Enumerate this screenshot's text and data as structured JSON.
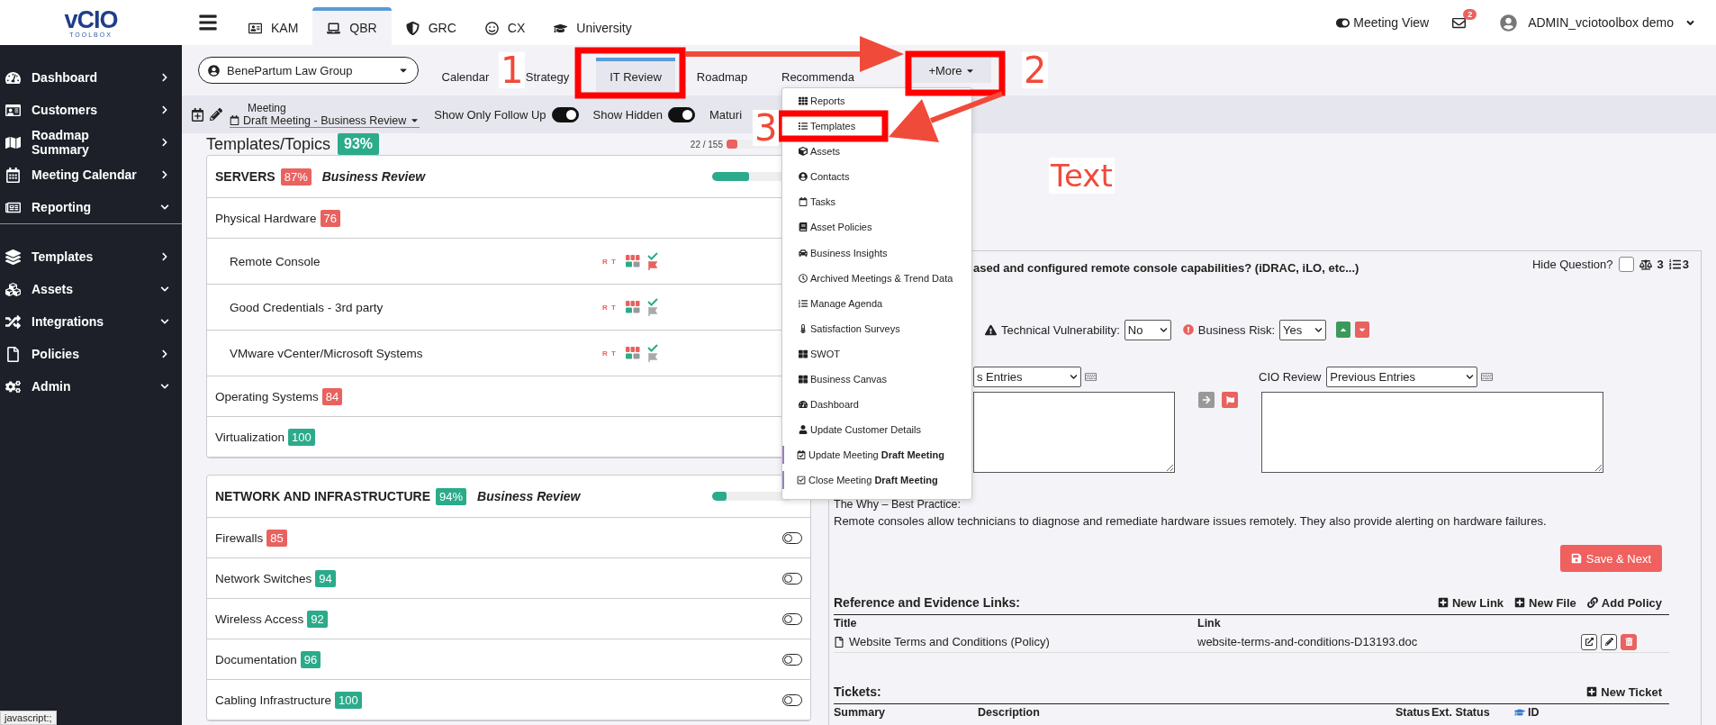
{
  "logo": {
    "name": "vCIO",
    "tagline": "TOOLBOX"
  },
  "sidebar": {
    "main_items": [
      {
        "label": "Dashboard",
        "expanded": false
      },
      {
        "label": "Customers",
        "expanded": false
      },
      {
        "label": "Roadmap Summary",
        "expanded": false
      },
      {
        "label": "Meeting Calendar",
        "expanded": false
      },
      {
        "label": "Reporting",
        "expanded": true
      }
    ],
    "setup_items": [
      {
        "label": "Templates",
        "expanded": false
      },
      {
        "label": "Assets",
        "expanded": true
      },
      {
        "label": "Integrations",
        "expanded": true
      },
      {
        "label": "Policies",
        "expanded": false
      },
      {
        "label": "Admin",
        "expanded": true
      }
    ]
  },
  "top_tabs": [
    {
      "label": "KAM",
      "selected": false
    },
    {
      "label": "QBR",
      "selected": true
    },
    {
      "label": "GRC",
      "selected": false
    },
    {
      "label": "CX",
      "selected": false
    },
    {
      "label": "University",
      "selected": false
    }
  ],
  "header_right": {
    "meeting_view": "Meeting View",
    "mail_count": "2",
    "user": "ADMIN_vciotoolbox demo"
  },
  "customer_select": {
    "value": "BenePartum Law Group"
  },
  "sub_tabs": [
    {
      "label": "Calendar",
      "selected": false
    },
    {
      "label": "Strategy",
      "selected": false
    },
    {
      "label": "IT Review",
      "selected": true
    },
    {
      "label": "Roadmap",
      "selected": false
    },
    {
      "label": "Recommenda",
      "selected": false
    }
  ],
  "more_button": "+More",
  "meeting_bar": {
    "label": "Meeting",
    "value": "Draft Meeting - Business Review",
    "toggles": [
      {
        "label": "Show Only Follow Up",
        "on": true
      },
      {
        "label": "Show Hidden",
        "on": true
      }
    ],
    "cut_label": "Maturi"
  },
  "topics": {
    "title": "Templates/Topics",
    "score": "93%",
    "progress_text": "22 / 155",
    "level": 0.14,
    "sections": [
      {
        "name": "SERVERS",
        "score": "87%",
        "color": "#e8625f",
        "meeting": "Business Review",
        "level": 0.45,
        "topics": [
          {
            "name": "Physical Hardware",
            "score": "76",
            "color": "#e8625f",
            "children": [
              {
                "name": "Remote Console",
                "tag": "R T",
                "flagged": true
              },
              {
                "name": "Good Credentials - 3rd party",
                "tag": "R T",
                "flagged": false
              },
              {
                "name": "VMware vCenter/Microsoft Systems",
                "tag": "R T",
                "flagged": false
              }
            ]
          },
          {
            "name": "Operating Systems",
            "score": "84",
            "color": "#e8625f"
          },
          {
            "name": "Virtualization",
            "score": "100",
            "color": "#2bab8a"
          }
        ]
      },
      {
        "name": "NETWORK AND INFRASTRUCTURE",
        "score": "94%",
        "color": "#2bab8a",
        "meeting": "Business Review",
        "level": 0.18,
        "topics": [
          {
            "name": "Firewalls",
            "score": "85",
            "color": "#e8625f",
            "on": false
          },
          {
            "name": "Network Switches",
            "score": "94",
            "color": "#2bab8a",
            "on": false
          },
          {
            "name": "Wireless Access",
            "score": "92",
            "color": "#2bab8a",
            "on": false
          },
          {
            "name": "Documentation",
            "score": "96",
            "color": "#2bab8a",
            "on": false
          },
          {
            "name": "Cabling Infrastructure",
            "score": "100",
            "color": "#2bab8a",
            "on": false
          }
        ]
      }
    ]
  },
  "more_menu": {
    "items": [
      {
        "label": "Reports",
        "accent": false
      },
      {
        "label": "Templates",
        "accent": false
      },
      {
        "label": "Assets",
        "accent": false
      },
      {
        "label": "Contacts",
        "accent": false
      },
      {
        "label": "Tasks",
        "accent": false
      },
      {
        "label": "Asset Policies",
        "accent": false
      },
      {
        "label": "Business Insights",
        "accent": false
      },
      {
        "label": "Archived Meetings & Trend Data",
        "accent": false
      },
      {
        "label": "Manage Agenda",
        "accent": false
      },
      {
        "label": "Satisfaction Surveys",
        "accent": false
      },
      {
        "label": "SWOT",
        "accent": false
      },
      {
        "label": "Business Canvas",
        "accent": false
      },
      {
        "label": "Dashboard",
        "accent": false
      },
      {
        "label": "Update Customer Details",
        "accent": false
      },
      {
        "label": "Update Meeting **Draft Meeting**",
        "accent": true
      },
      {
        "label": "Close Meeting **Draft Meeting**",
        "accent": true
      }
    ]
  },
  "annotations": [
    {
      "kind": "number",
      "text": "1"
    },
    {
      "kind": "number",
      "text": "2"
    },
    {
      "kind": "number",
      "text": "3"
    },
    {
      "kind": "note",
      "text": "Text"
    }
  ],
  "question": {
    "title": "ased and configured remote console capabilities? (iDRAC, iLO, etc...)",
    "hide_label": "Hide Question?",
    "hidden": false,
    "weight": "3",
    "count": "3",
    "vulnerability": {
      "label": "Technical Vulnerability:",
      "value": "No"
    },
    "risk": {
      "label": "Business Risk:",
      "value": "Yes"
    },
    "entries_left": {
      "value": "s Entries"
    },
    "cio_review": {
      "label": "CIO Review",
      "value": "Previous Entries"
    },
    "why_label": "The Why – Best Practice:",
    "why_text": "Remote consoles allow technicians to diagnose and remediate hardware issues remotely. They also provide alerting on hardware failures.",
    "save_button": "Save & Next"
  },
  "references": {
    "title": "Reference and Evidence Links:",
    "actions": [
      "New Link",
      "New File",
      "Add Policy"
    ],
    "columns": [
      "Title",
      "Link"
    ],
    "rows": [
      {
        "title": "Website Terms and Conditions (Policy)",
        "link": "website-terms-and-conditions-D13193.doc"
      }
    ]
  },
  "tickets": {
    "title": "Tickets:",
    "action": "New Ticket",
    "columns": [
      "Summary",
      "Description",
      "Status",
      "Ext. Status",
      "ID"
    ]
  },
  "status_bar": "javascript:;"
}
